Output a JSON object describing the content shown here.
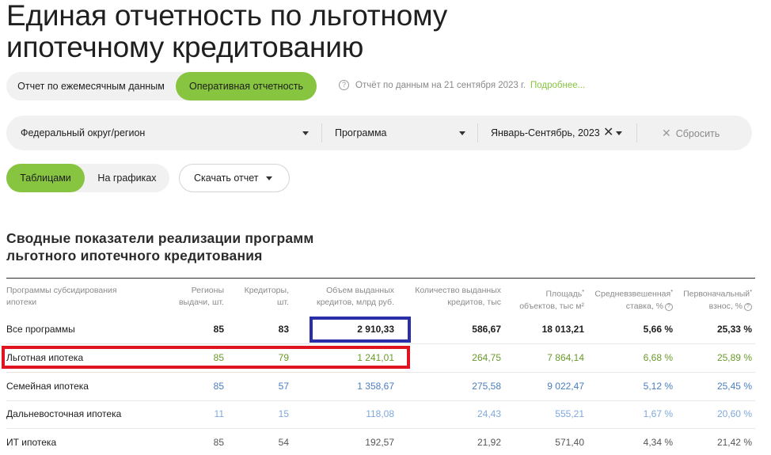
{
  "page": {
    "title": "Единая отчетность по льготному ипотечному кредитованию"
  },
  "mode_toggle": {
    "monthly": "Отчет по ежемесячным данным",
    "operational": "Оперативная отчетность"
  },
  "report_note": {
    "text": "Отчёт по данным на 21 сентября 2023 г.",
    "link": "Подробнее..."
  },
  "filters": {
    "region": "Федеральный округ/регион",
    "program": "Программа",
    "period": "Январь-Сентябрь, 2023",
    "reset": "Сбросить"
  },
  "view_toggle": {
    "tables": "Таблицами",
    "charts": "На графиках"
  },
  "download": {
    "label": "Скачать отчет"
  },
  "section": {
    "title": "Сводные показатели реализации программ льготного ипотечного кредитования"
  },
  "table": {
    "headers": {
      "program_l1": "Программы субсидирования",
      "program_l2": "ипотеки",
      "regions_l1": "Регионы",
      "regions_l2": "выдачи, шт.",
      "creditors_l1": "Кредиторы,",
      "creditors_l2": "шт.",
      "volume_l1": "Объем выданных",
      "volume_l2": "кредитов, млрд руб.",
      "count_l1": "Количество выданных",
      "count_l2": "кредитов, тыс",
      "area_l1": "Площадь",
      "area_l2": "объектов, тыс м²",
      "rate_l1": "Средневзвешенная",
      "rate_l2": "ставка, %",
      "down_l1": "Первоначальный",
      "down_l2": "взнос, %"
    },
    "rows": [
      {
        "name": "Все программы",
        "regions": "85",
        "creditors": "83",
        "volume": "2 910,33",
        "count": "586,67",
        "area": "18 013,21",
        "rate": "5,66 %",
        "down": "25,33 %"
      },
      {
        "name": "Льготная ипотека",
        "regions": "85",
        "creditors": "79",
        "volume": "1 241,01",
        "count": "264,75",
        "area": "7 864,14",
        "rate": "6,68 %",
        "down": "25,89 %"
      },
      {
        "name": "Семейная ипотека",
        "regions": "85",
        "creditors": "57",
        "volume": "1 358,67",
        "count": "275,58",
        "area": "9 022,47",
        "rate": "5,12 %",
        "down": "25,45 %"
      },
      {
        "name": "Дальневосточная ипотека",
        "regions": "11",
        "creditors": "15",
        "volume": "118,08",
        "count": "24,43",
        "area": "555,21",
        "rate": "1,67 %",
        "down": "20,60 %"
      },
      {
        "name": "ИТ ипотека",
        "regions": "85",
        "creditors": "54",
        "volume": "192,57",
        "count": "21,92",
        "area": "571,40",
        "rate": "4,34 %",
        "down": "21,42 %"
      }
    ]
  },
  "colors": {
    "accent_green": "#87c540",
    "highlight_blue": "#2a2ea8",
    "highlight_red": "#e0141e"
  }
}
